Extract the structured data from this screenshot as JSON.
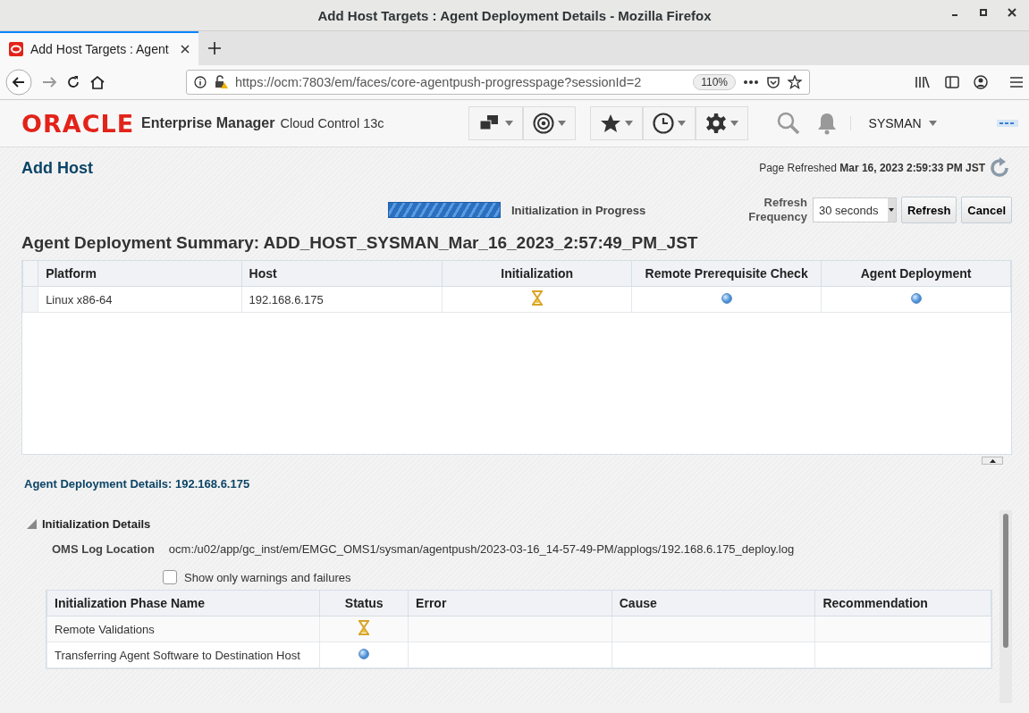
{
  "window": {
    "title": "Add Host Targets : Agent Deployment Details - Mozilla Firefox"
  },
  "browser": {
    "tab": {
      "title": "Add Host Targets : Agent",
      "selected": true
    },
    "url": "https://ocm:7803/em/faces/core-agentpush-progresspage?sessionId=2",
    "zoom": "110%"
  },
  "header": {
    "logo": "ORACLE",
    "product": "Enterprise Manager",
    "edition": "Cloud Control 13c",
    "user": "SYSMAN"
  },
  "page": {
    "title": "Add Host",
    "refreshed_label": "Page Refreshed",
    "refreshed_time": "Mar 16, 2023 2:59:33 PM JST"
  },
  "progress": {
    "level": 1,
    "status": "Initialization in Progress"
  },
  "refresh": {
    "label": "Refresh Frequency",
    "value": "30 seconds",
    "refresh_button": "Refresh",
    "cancel_button": "Cancel"
  },
  "summary": {
    "title": "Agent Deployment Summary: ADD_HOST_SYSMAN_Mar_16_2023_2:57:49_PM_JST",
    "columns": [
      "Platform",
      "Host",
      "Initialization",
      "Remote Prerequisite Check",
      "Agent Deployment"
    ],
    "rows": [
      {
        "platform": "Linux x86-64",
        "host": "192.168.6.175",
        "statuses": [
          {
            "kind": "in_progress"
          },
          {
            "kind": "pending"
          },
          {
            "kind": "pending"
          }
        ]
      }
    ]
  },
  "details": {
    "title": "Agent Deployment Details: 192.168.6.175",
    "section": "Initialization Details",
    "expanded": true,
    "log_label": "OMS Log Location",
    "log_value": "ocm:/u02/app/gc_inst/em/EMGC_OMS1/sysman/agentpush/2023-03-16_14-57-49-PM/applogs/192.168.6.175_deploy.log",
    "filter": {
      "label": "Show only warnings and failures",
      "checked": false
    },
    "columns": [
      "Initialization Phase Name",
      "Status",
      "Error",
      "Cause",
      "Recommendation"
    ],
    "rows": [
      {
        "name": "Remote Validations",
        "status": {
          "kind": "in_progress"
        }
      },
      {
        "name": "Transferring Agent Software to Destination Host",
        "status": {
          "kind": "pending"
        }
      }
    ]
  }
}
